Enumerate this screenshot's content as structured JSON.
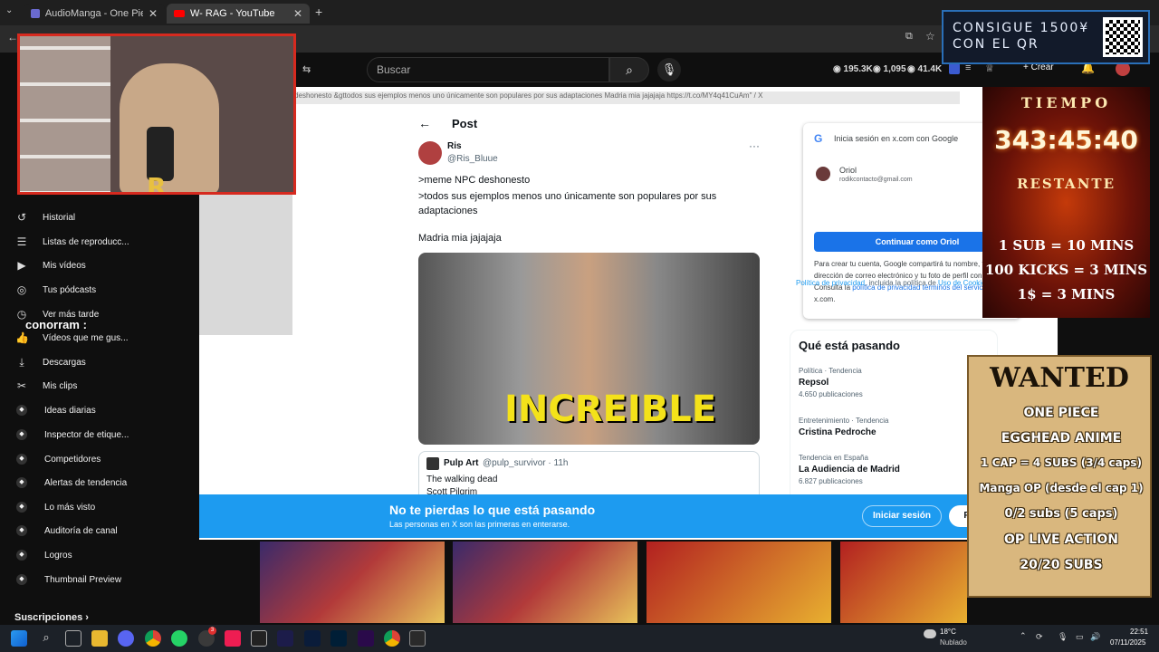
{
  "browser": {
    "tabs": [
      {
        "title": "AudioManga - One Piece Elbap",
        "active": false
      },
      {
        "title": "W- RAG - YouTube",
        "active": true
      }
    ],
    "new_tab": "+"
  },
  "youtube": {
    "search_placeholder": "Buscar",
    "stats": {
      "views": "195.3K",
      "watchers": "1,095",
      "likes": "41.4K"
    },
    "create_label": "Crear",
    "sidebar": [
      {
        "label": "Historial",
        "icon": "history-icon"
      },
      {
        "label": "Listas de reproducc...",
        "icon": "playlist-icon"
      },
      {
        "label": "Mis vídeos",
        "icon": "video-icon"
      },
      {
        "label": "Tus pódcasts",
        "icon": "podcast-icon"
      },
      {
        "label": "Ver más tarde",
        "icon": "clock-icon"
      },
      {
        "label": "Vídeos que me gus...",
        "icon": "thumbs-up-icon"
      },
      {
        "label": "Descargas",
        "icon": "download-icon"
      },
      {
        "label": "Mis clips",
        "icon": "scissors-icon"
      },
      {
        "label": "Ideas diarias",
        "icon": "app-icon"
      },
      {
        "label": "Inspector de etique...",
        "icon": "app-icon"
      },
      {
        "label": "Competidores",
        "icon": "app-icon"
      },
      {
        "label": "Alertas de tendencia",
        "icon": "app-icon"
      },
      {
        "label": "Lo más visto",
        "icon": "app-icon"
      },
      {
        "label": "Auditoría de canal",
        "icon": "app-icon"
      },
      {
        "label": "Logros",
        "icon": "app-icon"
      },
      {
        "label": "Thumbnail Preview",
        "icon": "app-icon"
      }
    ],
    "subscriptions_label": "Suscripciones",
    "chat_user": "conorram :"
  },
  "xpage": {
    "url_text": "\" deshonesto &gttodos sus ejemplos menos uno únicamente son populares por sus adaptaciones Madria mia jajajaja https://t.co/MY4q41CuAm\" / X",
    "post_header": "Post",
    "author_name": "Ris",
    "author_handle": "@Ris_Bluue",
    "tweet_lines": [
      ">meme NPC deshonesto",
      ">todos sus ejemplos menos uno únicamente son populares por sus adaptaciones"
    ],
    "tweet_extra": "Madria mia jajajaja",
    "image_caption": "INCREIBLE",
    "quote": {
      "author": "Pulp Art",
      "handle": "@pulp_survivor · 11h",
      "lines": [
        "The walking dead",
        "Scott Pilgrim"
      ]
    },
    "google_signin": {
      "title": "Inicia sesión en x.com con Google",
      "account_name": "Oriol",
      "account_email": "rodikcontacto@gmail.com",
      "continue_button": "Continuar como Oriol",
      "disclaimer": "Para crear tu cuenta, Google compartirá tu nombre, tu dirección de correo electrónico y tu foto de perfil con x.com. Consulta la",
      "privacy_link": "política de privacidad",
      "terms_link": "términos del servicio",
      "disclaimer_end": "de x.com."
    },
    "side_snippet_link": "Política de privacidad",
    "side_snippet_text": ", incluida la política de",
    "side_snippet_link2": "Uso de",
    "side_snippet_cookies": "Cookies.",
    "trends_title": "Qué está pasando",
    "trends": [
      {
        "context": "Política · Tendencia",
        "name": "Repsol",
        "count": "4.650 publicaciones"
      },
      {
        "context": "Entretenimiento · Tendencia",
        "name": "Cristina Pedroche",
        "count": ""
      },
      {
        "context": "Tendencia en España",
        "name": "La Audiencia de Madrid",
        "count": "6.827 publicaciones"
      }
    ],
    "banner": {
      "title": "No te pierdas lo que está pasando",
      "subtitle": "Las personas en X son las primeras en enterarse.",
      "login_button": "Iniciar sesión",
      "register_button": "R"
    }
  },
  "overlays": {
    "qr_text_line1": "CONSIGUE 1500¥",
    "qr_text_line2": "CON EL QR",
    "timer_label": "TIEMPO",
    "timer_value": "343:45:40",
    "timer_sub": "RESTANTE",
    "timer_rules": [
      "1 SUB = 10 MINS",
      "100 KICKS = 3 MINS",
      "1$ = 3 MINS"
    ],
    "wanted": {
      "title": "WANTED",
      "lines": [
        "ONE PIECE",
        "EGGHEAD ANIME",
        "1 CAP = 4 SUBS (3/4 caps)",
        "Manga OP (desde el cap 1)",
        "0/2 subs (5 caps)",
        "OP LIVE ACTION",
        "20/20 SUBS"
      ]
    }
  },
  "taskbar": {
    "weather_temp": "18°C",
    "weather_desc": "Nublado",
    "time": "22:51",
    "date": "07/11/2025",
    "badge": "3"
  }
}
